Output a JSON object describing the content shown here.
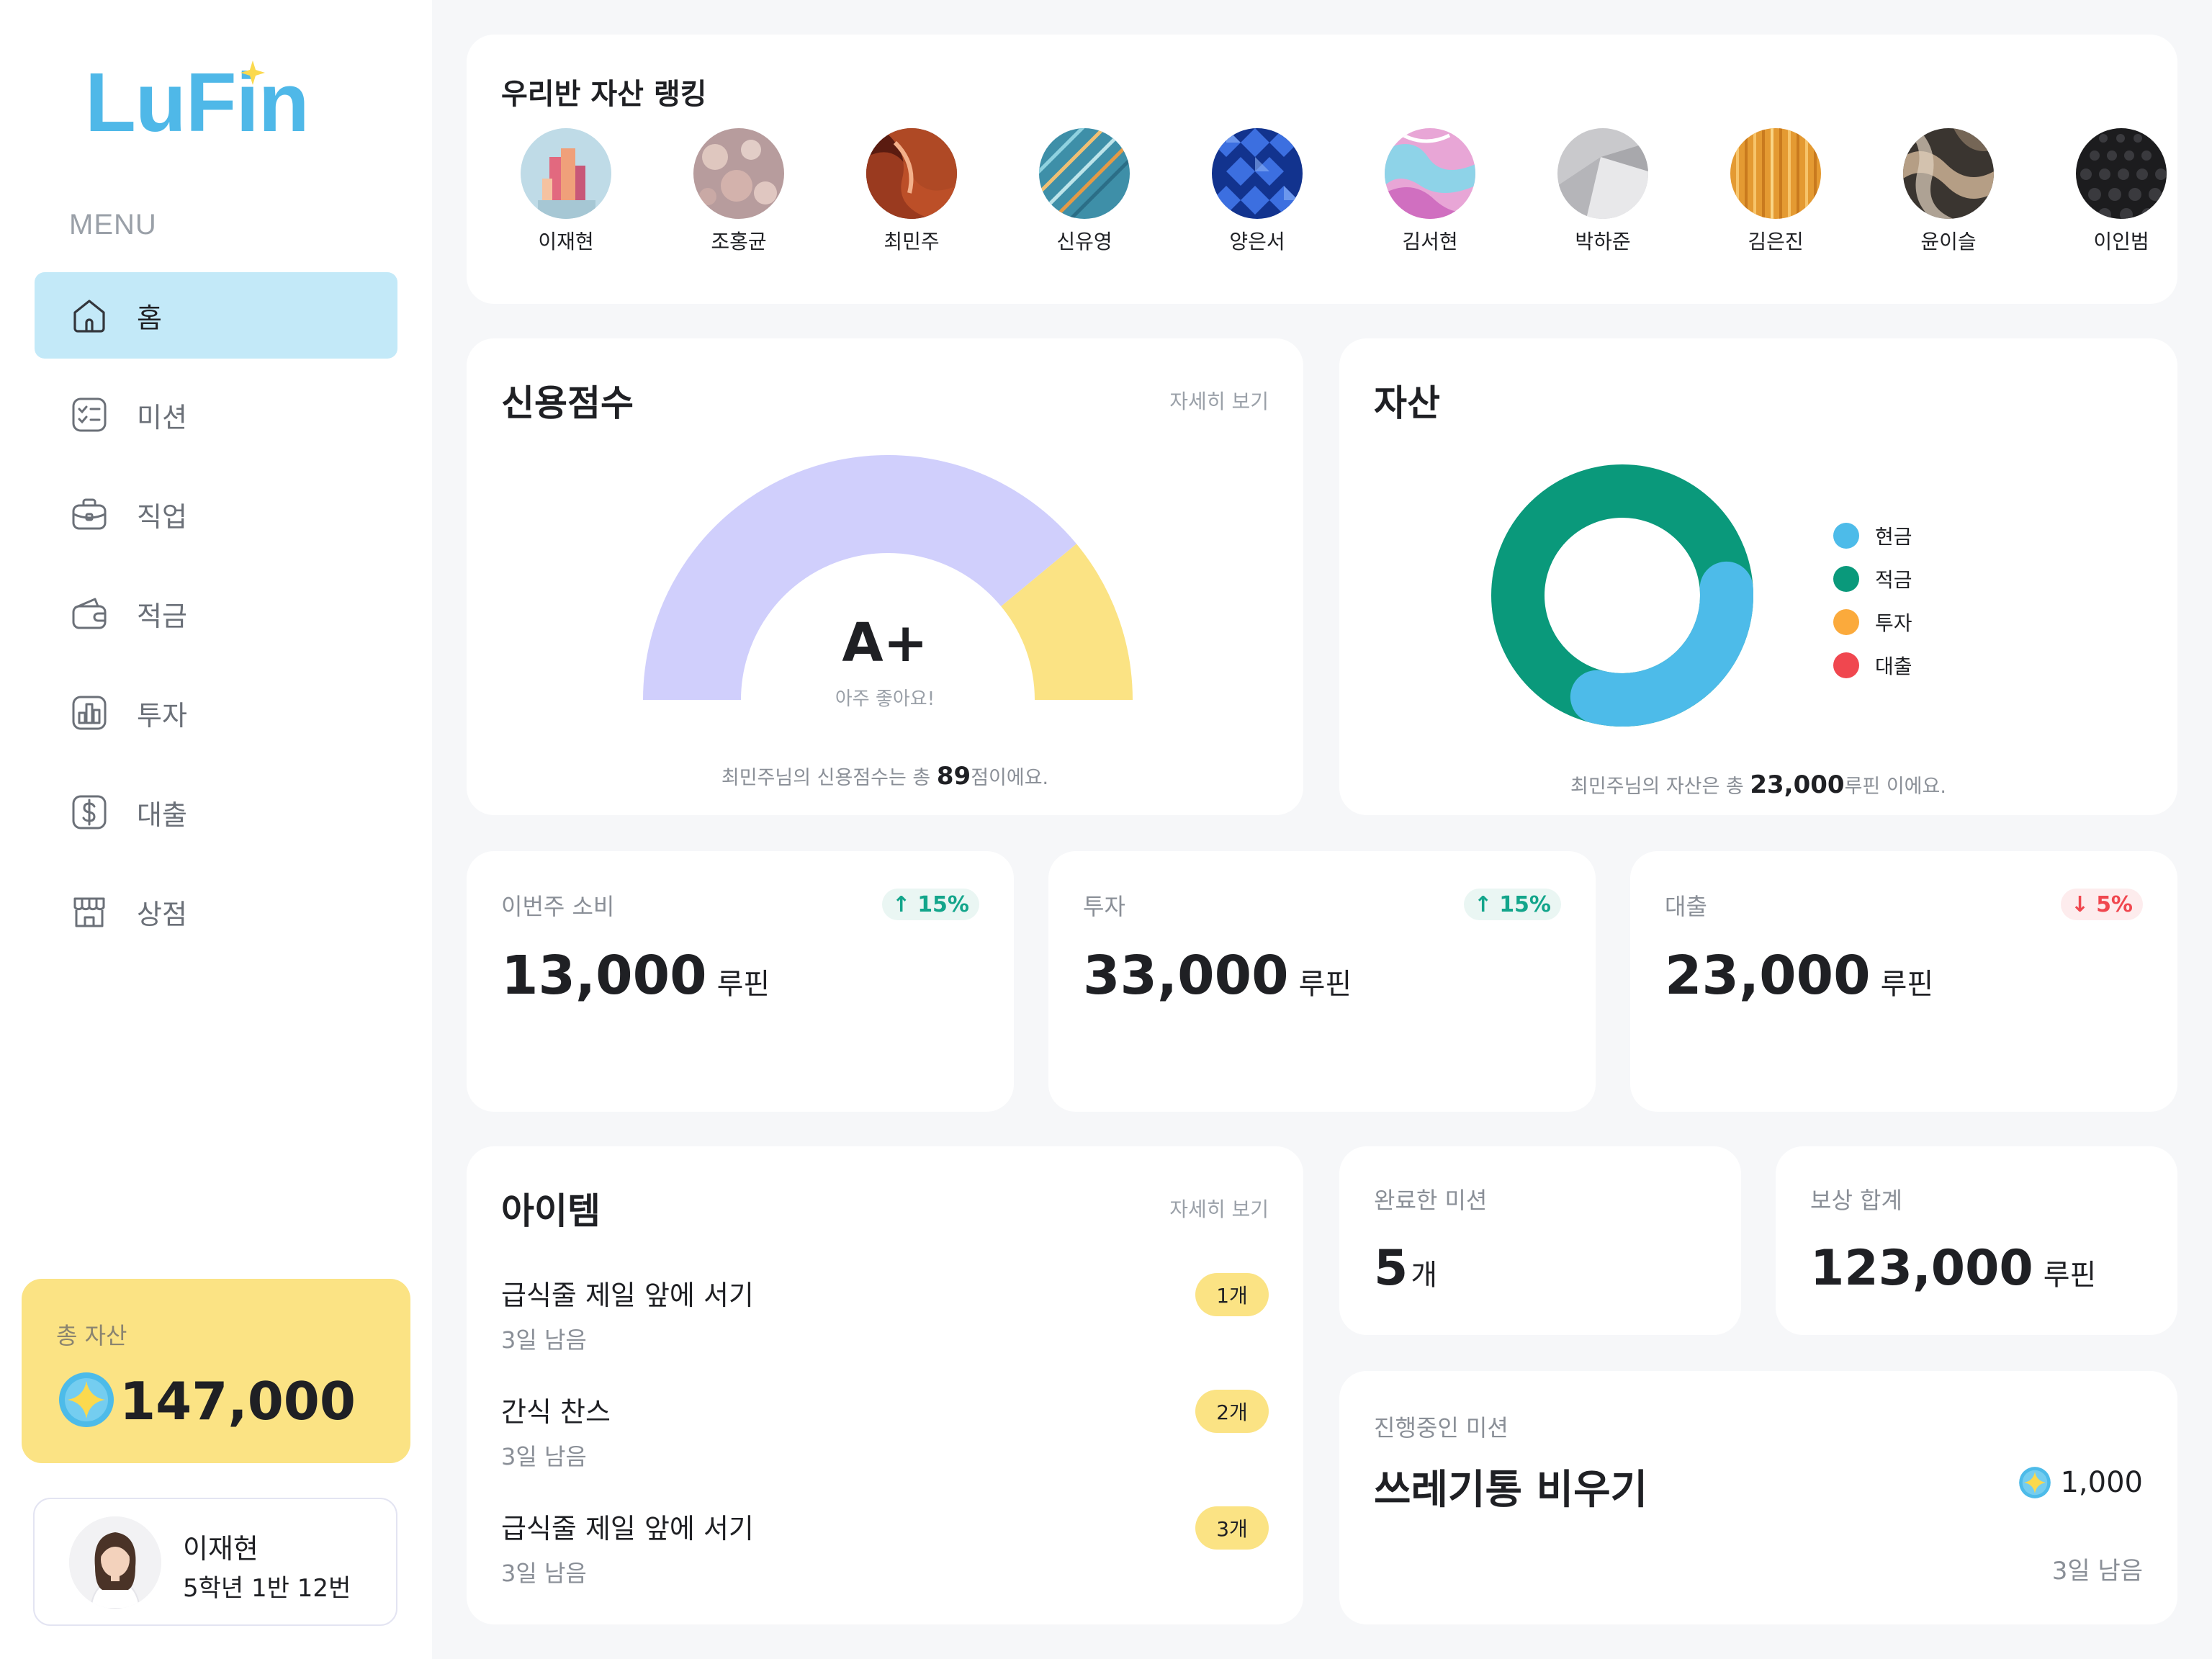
{
  "brand": {
    "name": "LuFin"
  },
  "menu": {
    "heading": "MENU",
    "items": [
      {
        "label": "홈",
        "icon": "home-icon",
        "active": true
      },
      {
        "label": "미션",
        "icon": "checklist-icon"
      },
      {
        "label": "직업",
        "icon": "briefcase-icon"
      },
      {
        "label": "적금",
        "icon": "wallet-icon"
      },
      {
        "label": "투자",
        "icon": "bar-chart-icon"
      },
      {
        "label": "대출",
        "icon": "dollar-icon"
      },
      {
        "label": "상점",
        "icon": "store-icon"
      }
    ]
  },
  "total_assets": {
    "label": "총 자산",
    "value": "147,000"
  },
  "profile": {
    "name": "이재현",
    "meta": "5학년 1반 12번"
  },
  "ranking": {
    "title": "우리반 자산 랭킹",
    "members": [
      "이재현",
      "조홍균",
      "최민주",
      "신유영",
      "양은서",
      "김서현",
      "박하준",
      "김은진",
      "윤이슬",
      "이인범"
    ]
  },
  "credit": {
    "title": "신용점수",
    "detail_link": "자세히 보기",
    "grade": "A+",
    "grade_note": "아주 좋아요!",
    "foot_prefix": "최민주님의 신용점수는 총 ",
    "score": "89",
    "foot_suffix": "점이에요.",
    "gauge_fill": 0.78,
    "colors": {
      "fill": "#d0cffc",
      "rest": "#fbe384"
    }
  },
  "assets": {
    "title": "자산",
    "legend": [
      {
        "label": "현금",
        "color": "#4dbbe9"
      },
      {
        "label": "적금",
        "color": "#0a997b"
      },
      {
        "label": "투자",
        "color": "#fbaa3c"
      },
      {
        "label": "대출",
        "color": "#f0474f"
      }
    ],
    "shares": {
      "현금": 0.3,
      "적금": 0.7
    },
    "foot_prefix": "최민주님의 자산은 총 ",
    "total": "23,000",
    "foot_suffix": "루핀 이에요."
  },
  "stats": [
    {
      "label": "이번주 소비",
      "change": "15%",
      "direction": "up",
      "value": "13,000",
      "unit": "루핀"
    },
    {
      "label": "투자",
      "change": "15%",
      "direction": "up",
      "value": "33,000",
      "unit": "루핀"
    },
    {
      "label": "대출",
      "change": "5%",
      "direction": "down",
      "value": "23,000",
      "unit": "루핀"
    }
  ],
  "items": {
    "title": "아이템",
    "detail_link": "자세히 보기",
    "list": [
      {
        "name": "급식줄 제일 앞에 서기",
        "left": "3일 남음",
        "count": "1개"
      },
      {
        "name": "간식 찬스",
        "left": "3일 남음",
        "count": "2개"
      },
      {
        "name": "급식줄 제일 앞에 서기",
        "left": "3일 남음",
        "count": "3개"
      }
    ]
  },
  "completed_missions": {
    "label": "완료한 미션",
    "value": "5",
    "unit": "개"
  },
  "reward_total": {
    "label": "보상 합계",
    "value": "123,000",
    "unit": "루핀"
  },
  "ongoing_mission": {
    "label": "진행중인 미션",
    "title": "쓰레기통 비우기",
    "reward": "1,000",
    "left": "3일 남음"
  }
}
